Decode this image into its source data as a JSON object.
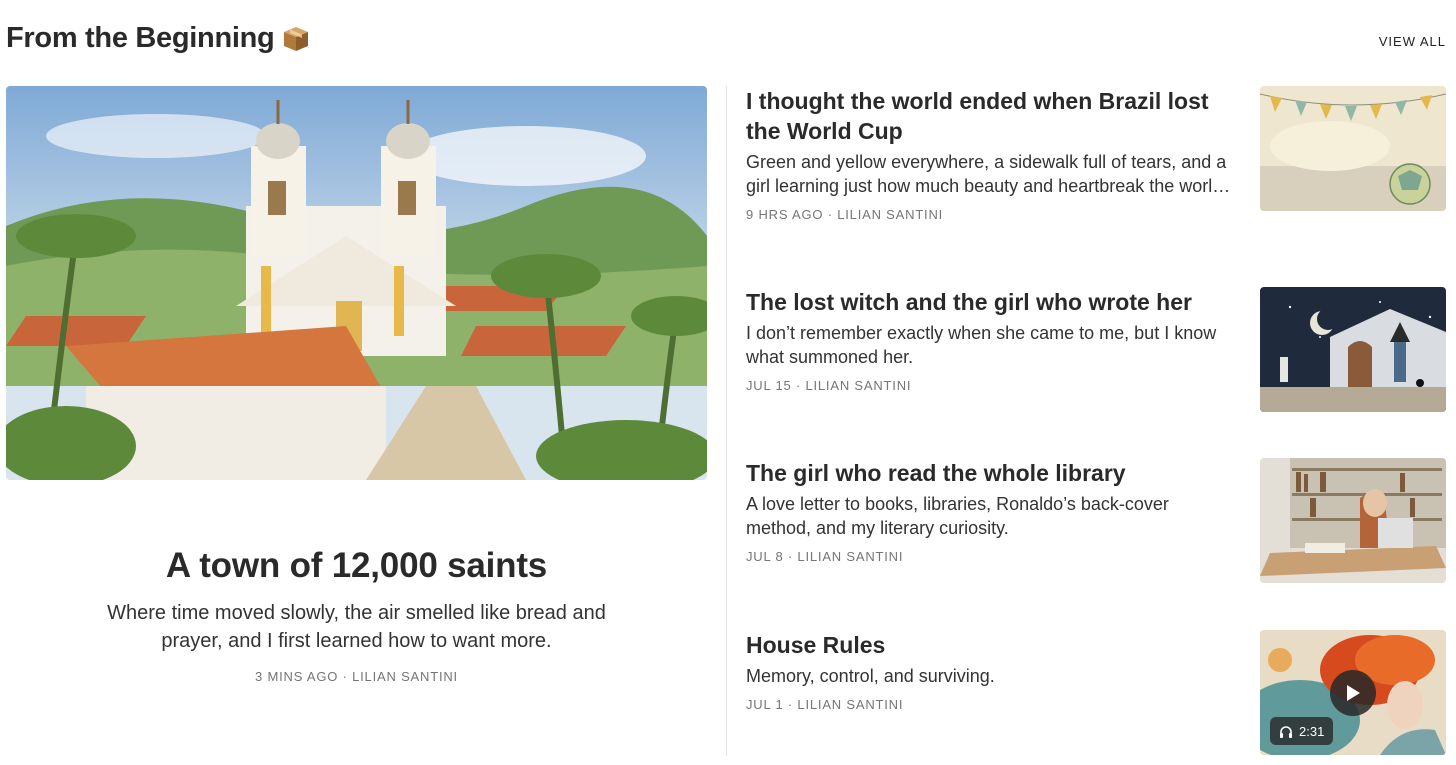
{
  "section": {
    "title": "From the Beginning",
    "title_icon": "package-box-icon",
    "view_all_label": "VIEW ALL"
  },
  "featured": {
    "title": "A town of 12,000 saints",
    "subtitle": "Where time moved slowly, the air smelled like bread and prayer, and I first learned how to want more.",
    "meta": "3 MINS AGO · LILIAN SANTINI",
    "image": "watercolor-colonial-church-town"
  },
  "posts": [
    {
      "title": "I thought the world ended when Brazil lost the World Cup",
      "subtitle": "Green and yellow everywhere, a sidewalk full of tears, and a girl learning just how much beauty and heartbreak the world can hold.",
      "meta": "9 HRS AGO · LILIAN SANTINI",
      "image": "watercolor-bunting-and-soccer-ball"
    },
    {
      "title": "The lost witch and the girl who wrote her",
      "subtitle": "I don’t remember exactly when she came to me, but I know what summoned her.",
      "meta": "JUL 15 · LILIAN SANTINI",
      "image": "watercolor-witch-at-night-house"
    },
    {
      "title": "The girl who read the whole library",
      "subtitle": "A love letter to books, libraries, Ronaldo’s back-cover method, and my literary curiosity.",
      "meta": "JUL 8 · LILIAN SANTINI",
      "image": "watercolor-girl-reading-in-library"
    },
    {
      "title": "House Rules",
      "subtitle": "Memory, control, and surviving.",
      "meta": "JUL 1 · LILIAN SANTINI",
      "image": "watercolor-red-haired-woman",
      "audio_duration": "2:31",
      "play_icon": "play-icon",
      "headphones_icon": "headphones-icon"
    }
  ]
}
